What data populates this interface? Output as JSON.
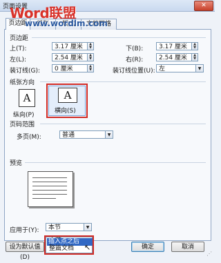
{
  "window": {
    "title": "页面设置",
    "close_label": "✕"
  },
  "watermark": {
    "brand": "Word联盟",
    "url": "www.wordlm.com"
  },
  "tabs": [
    {
      "label": "页边距"
    },
    {
      "label": "纸张"
    },
    {
      "label": "版式"
    },
    {
      "label": "文档网格"
    }
  ],
  "margins": {
    "section": "页边距",
    "top": {
      "label": "上(T):",
      "value": "3.17 厘米"
    },
    "bottom": {
      "label": "下(B):",
      "value": "3.17 厘米"
    },
    "left": {
      "label": "左(L):",
      "value": "2.54 厘米"
    },
    "right": {
      "label": "右(R):",
      "value": "2.54 厘米"
    },
    "gutter": {
      "label": "装订线(G):",
      "value": "0 厘米"
    },
    "gutter_position": {
      "label": "装订线位置(U):",
      "value": "左"
    }
  },
  "orientation": {
    "section": "纸张方向",
    "portrait_label": "纵向(P)",
    "landscape_label": "横向(S)",
    "glyph": "A"
  },
  "pages": {
    "section": "页码范围",
    "multiple_label": "多页(M):",
    "multiple_value": "普通"
  },
  "preview": {
    "section": "预览"
  },
  "apply": {
    "label": "应用于(Y):",
    "value": "本节",
    "options": [
      "本节",
      "插入点之后",
      "整篇文档"
    ]
  },
  "buttons": {
    "default": "设为默认值(D)",
    "ok": "确定",
    "cancel": "取消"
  },
  "colors": {
    "highlight_red": "#d12a24",
    "selection_blue": "#3168c4"
  }
}
